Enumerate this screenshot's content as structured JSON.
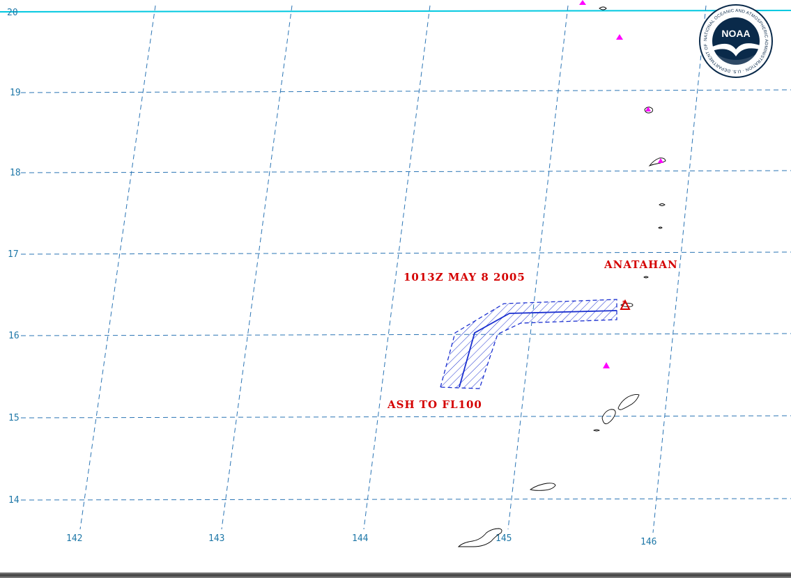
{
  "map": {
    "lat_labels": [
      "20",
      "19",
      "18",
      "17",
      "16",
      "15",
      "14"
    ],
    "lon_labels": [
      "142",
      "143",
      "144",
      "145",
      "146"
    ],
    "volcano_name": "ANATAHAN",
    "advisory_time": "1013Z MAY 8 2005",
    "ash_layer": "ASH TO FL100",
    "logo_text": "NOAA",
    "logo_ring_text": "NATIONAL OCEANIC AND ATMOSPHERIC ADMINISTRATION · U.S. DEPARTMENT OF COMMERCE",
    "colors": {
      "grid": "#2a74b4",
      "ash_polygon": "#1a2fd0",
      "label": "#d40000",
      "volcano_marker": "#ff00ff",
      "lat20_line": "#00c8e0",
      "noaa_navy": "#0a2a4a"
    },
    "icons": {
      "volcano_marker": "magenta-triangle",
      "eruption_point": "red-triangle"
    }
  }
}
